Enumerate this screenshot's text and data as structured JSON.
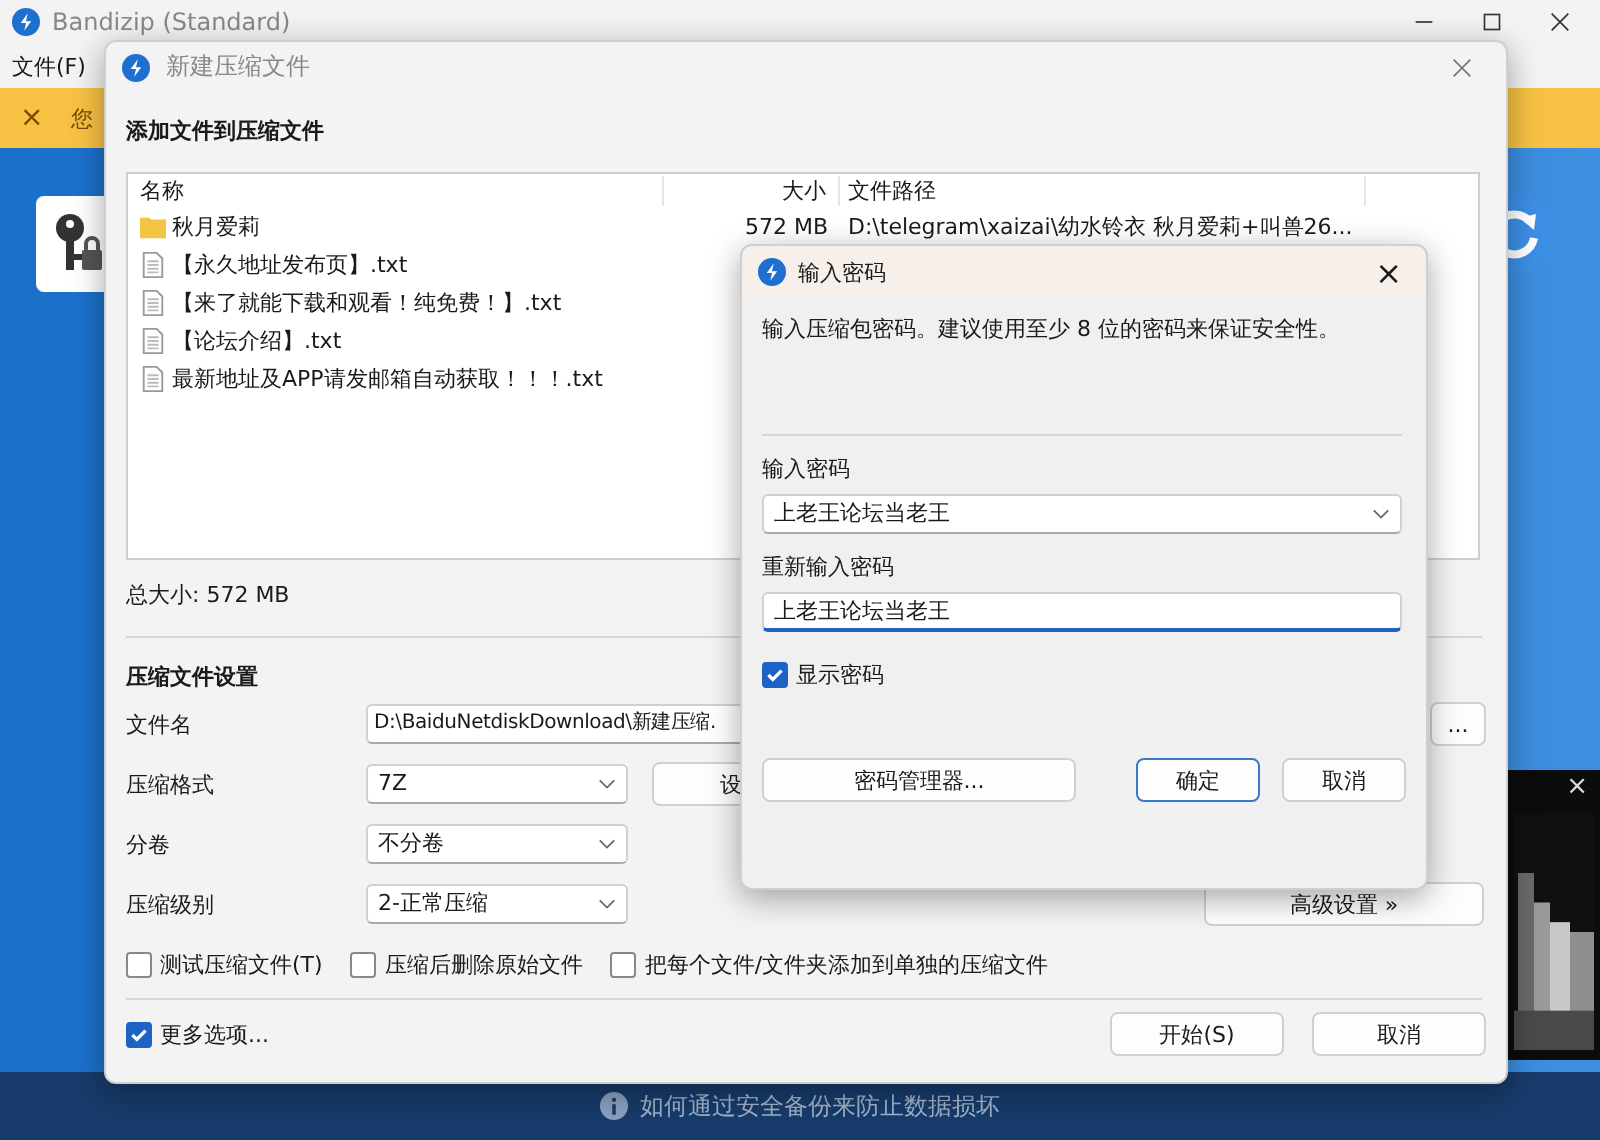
{
  "main_window": {
    "title": "Bandizip (Standard)",
    "menu": [
      "文件(F)"
    ],
    "banner": {
      "close": "×",
      "text": "您"
    },
    "footer_tip": "如何通过安全备份来防止数据损坏",
    "video_close": "×"
  },
  "new_archive_dialog": {
    "title": "新建压缩文件",
    "heading": "添加文件到压缩文件",
    "file_list": {
      "columns": [
        "名称",
        "大小",
        "文件路径"
      ],
      "rows": [
        {
          "kind": "folder",
          "name": "秋月爱莉",
          "size": "572 MB",
          "path": "D:\\telegram\\xaizai\\幼水铃衣 秋月爱莉+叫兽26..."
        },
        {
          "kind": "file",
          "name": "【永久地址发布页】.txt"
        },
        {
          "kind": "file",
          "name": "【来了就能下载和观看！纯免费！】.txt"
        },
        {
          "kind": "file",
          "name": "【论坛介绍】.txt"
        },
        {
          "kind": "file",
          "name": "最新地址及APP请发邮箱自动获取！！！.txt"
        }
      ]
    },
    "total_size": "总大小: 572 MB",
    "settings_title": "压缩文件设置",
    "file_name": {
      "label": "文件名",
      "value": "D:\\BaiduNetdiskDownload\\新建压缩.",
      "browse": "..."
    },
    "format": {
      "label": "压缩格式",
      "value": "7Z",
      "button": "设"
    },
    "split": {
      "label": "分卷",
      "value": "不分卷"
    },
    "level": {
      "label": "压缩级别",
      "value": "2-正常压缩"
    },
    "advanced": "高级设置 »",
    "options": [
      {
        "label": "测试压缩文件(T)",
        "checked": false
      },
      {
        "label": "压缩后删除原始文件",
        "checked": false
      },
      {
        "label": "把每个文件/文件夹添加到单独的压缩文件",
        "checked": false
      }
    ],
    "more_options": {
      "label": "更多选项...",
      "checked": true
    },
    "buttons": [
      "开始(S)",
      "取消"
    ]
  },
  "password_dialog": {
    "title": "输入密码",
    "close": "×",
    "message": "输入压缩包密码。建议使用至少 8 位的密码来保证安全性。",
    "password_label": "输入密码",
    "password": "上老王论坛当老王",
    "confirm_label": "重新输入密码",
    "confirm": "上老王论坛当老王",
    "show_password": {
      "label": "显示密码",
      "checked": true
    },
    "manager_button": "密码管理器...",
    "buttons": [
      "确定",
      "取消"
    ]
  }
}
